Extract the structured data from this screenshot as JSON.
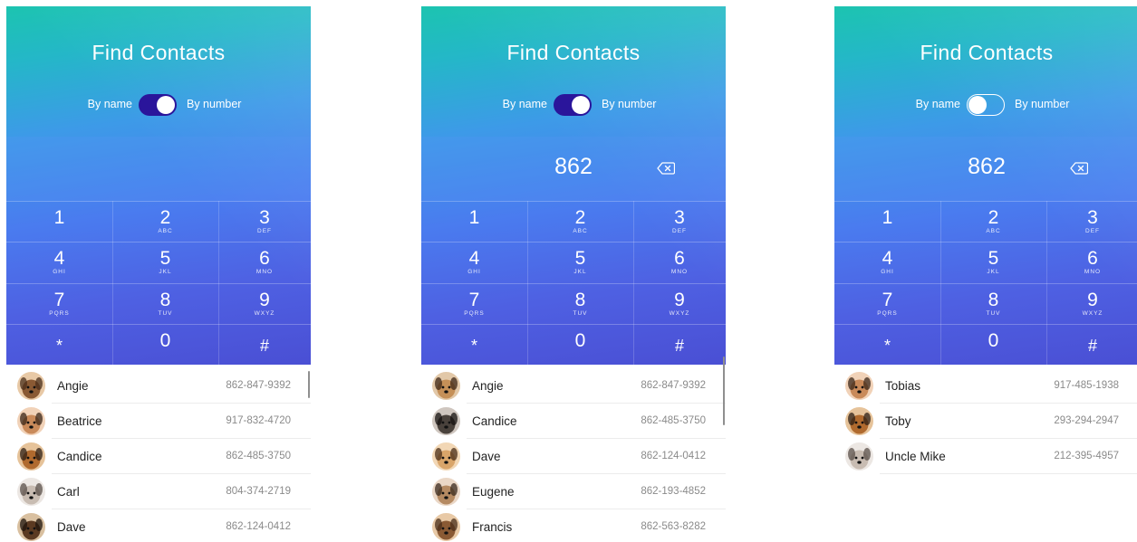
{
  "screens": [
    {
      "title": "Find Contacts",
      "toggle": {
        "left_label": "By name",
        "right_label": "By number",
        "state": "on"
      },
      "entered_number": "",
      "show_backspace": false,
      "contacts": [
        {
          "name": "Angie",
          "phone": "862-847-9392",
          "avatar": "dog-avatar"
        },
        {
          "name": "Beatrice",
          "phone": "917-832-4720",
          "avatar": "dog-avatar"
        },
        {
          "name": "Candice",
          "phone": "862-485-3750",
          "avatar": "dog-avatar"
        },
        {
          "name": "Carl",
          "phone": "804-374-2719",
          "avatar": "dog-avatar"
        },
        {
          "name": "Dave",
          "phone": "862-124-0412",
          "avatar": "dog-avatar"
        }
      ]
    },
    {
      "title": "Find Contacts",
      "toggle": {
        "left_label": "By name",
        "right_label": "By number",
        "state": "on"
      },
      "entered_number": "862",
      "show_backspace": true,
      "contacts": [
        {
          "name": "Angie",
          "phone": "862-847-9392",
          "avatar": "dog-avatar"
        },
        {
          "name": "Candice",
          "phone": "862-485-3750",
          "avatar": "dog-avatar"
        },
        {
          "name": "Dave",
          "phone": "862-124-0412",
          "avatar": "dog-avatar"
        },
        {
          "name": "Eugene",
          "phone": "862-193-4852",
          "avatar": "dog-avatar"
        },
        {
          "name": "Francis",
          "phone": "862-563-8282",
          "avatar": "dog-avatar"
        }
      ]
    },
    {
      "title": "Find Contacts",
      "toggle": {
        "left_label": "By name",
        "right_label": "By number",
        "state": "off"
      },
      "entered_number": "862",
      "show_backspace": true,
      "contacts": [
        {
          "name": "Tobias",
          "phone": "917-485-1938",
          "avatar": "dog-avatar"
        },
        {
          "name": "Toby",
          "phone": "293-294-2947",
          "avatar": "dog-avatar"
        },
        {
          "name": "Uncle Mike",
          "phone": "212-395-4957",
          "avatar": "dog-avatar"
        }
      ]
    }
  ],
  "keypad": [
    {
      "digit": "1",
      "letters": ""
    },
    {
      "digit": "2",
      "letters": "ABC"
    },
    {
      "digit": "3",
      "letters": "DEF"
    },
    {
      "digit": "4",
      "letters": "GHI"
    },
    {
      "digit": "5",
      "letters": "JKL"
    },
    {
      "digit": "6",
      "letters": "MNO"
    },
    {
      "digit": "7",
      "letters": "PQRS"
    },
    {
      "digit": "8",
      "letters": "TUV"
    },
    {
      "digit": "9",
      "letters": "WXYZ"
    },
    {
      "digit": "*",
      "letters": ""
    },
    {
      "digit": "0",
      "letters": ""
    },
    {
      "digit": "#",
      "letters": ""
    }
  ],
  "colors": {
    "gradient_top": "#1cc4b0",
    "gradient_mid": "#3d9ae8",
    "gradient_bottom": "#4a4fd4",
    "toggle_on": "#2a159b",
    "name_text": "#222222",
    "phone_text": "#8a8a8a"
  }
}
